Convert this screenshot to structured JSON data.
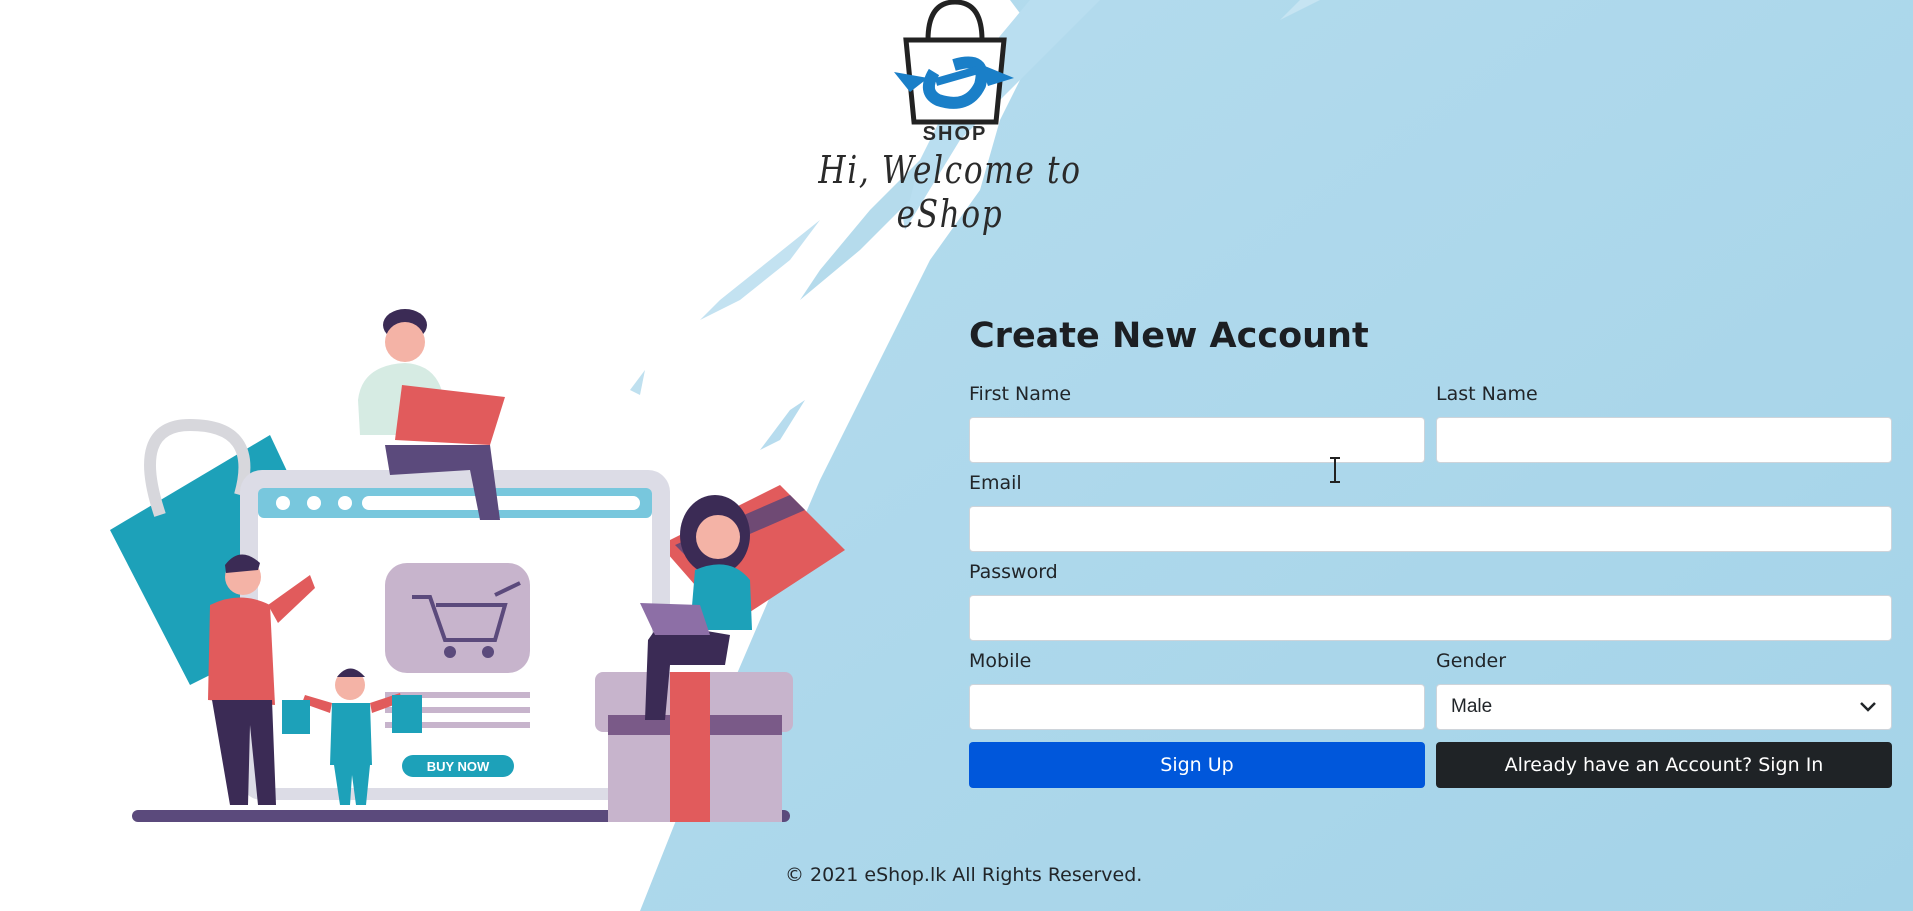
{
  "brand": {
    "logo_text": "SHOP",
    "welcome": "Hi, Welcome to eShop"
  },
  "illustration": {
    "button_label": "BUY NOW"
  },
  "form": {
    "title": "Create New Account",
    "first_name": {
      "label": "First Name",
      "value": "",
      "placeholder": ""
    },
    "last_name": {
      "label": "Last Name",
      "value": "",
      "placeholder": ""
    },
    "email": {
      "label": "Email",
      "value": "",
      "placeholder": ""
    },
    "password": {
      "label": "Password",
      "value": "",
      "placeholder": ""
    },
    "mobile": {
      "label": "Mobile",
      "value": "",
      "placeholder": ""
    },
    "gender": {
      "label": "Gender",
      "selected": "Male"
    },
    "signup_label": "Sign Up",
    "signin_label": "Already have an Account? Sign In"
  },
  "footer": {
    "text": "© 2021 eShop.lk All Rights Reserved."
  },
  "colors": {
    "primary": "#0057db",
    "dark": "#1f2326",
    "sky": "#a9d6ea"
  }
}
